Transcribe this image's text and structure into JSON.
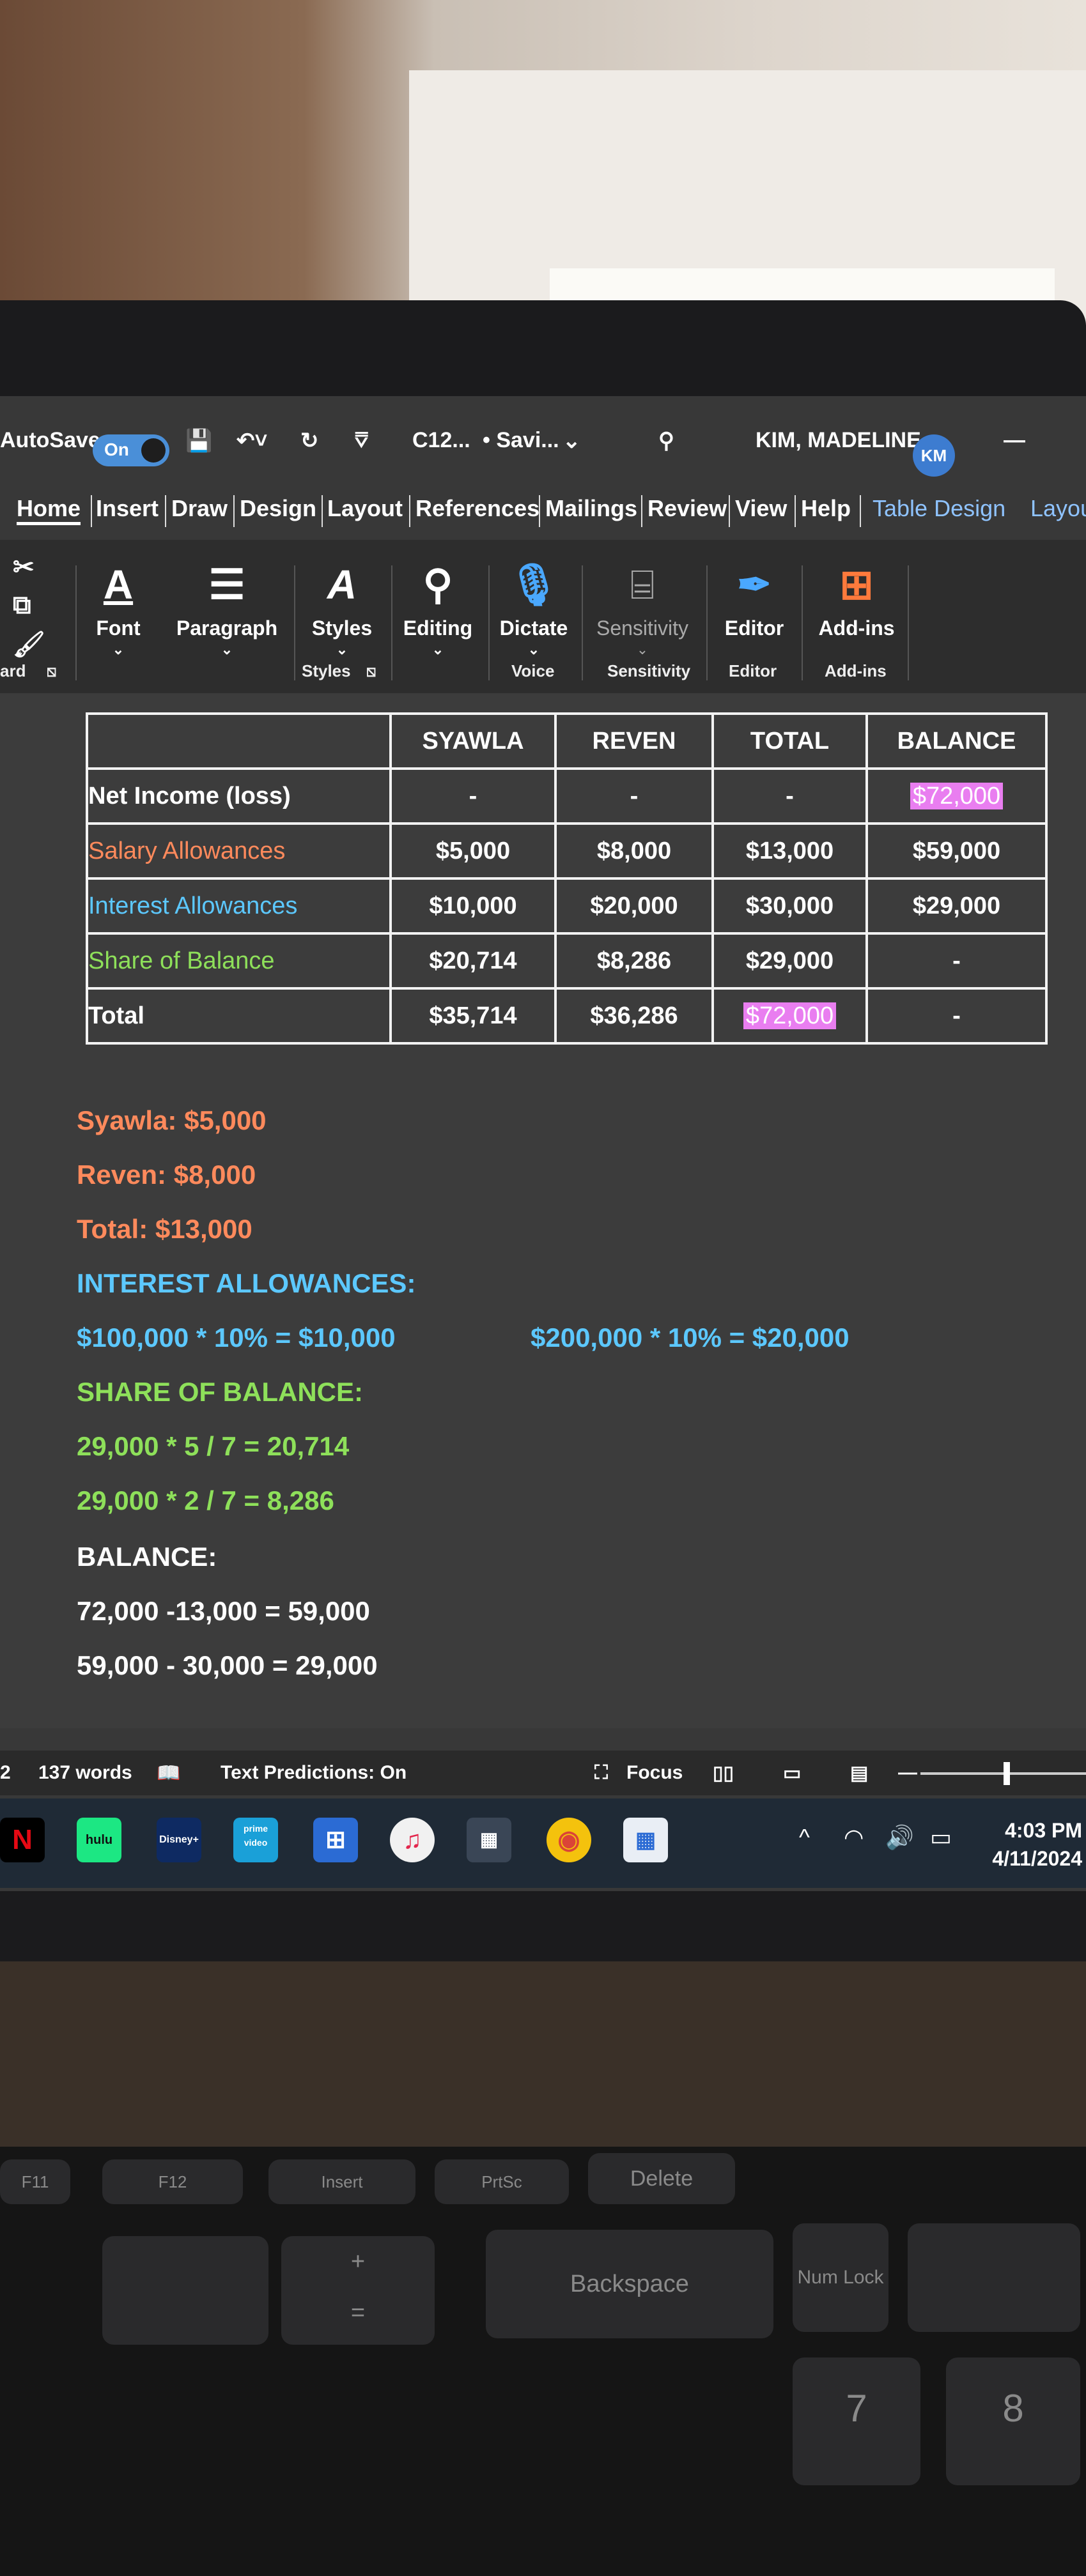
{
  "titlebar": {
    "autosave_label": "AutoSave",
    "autosave_state": "On",
    "filename": "C12...",
    "save_status": "• Savi...",
    "user_name": "KIM, MADELINE",
    "user_initials": "KM"
  },
  "tabs": [
    "Home",
    "Insert",
    "Draw",
    "Design",
    "Layout",
    "References",
    "Mailings",
    "Review",
    "View",
    "Help",
    "Table Design",
    "Layou"
  ],
  "ribbon": {
    "font": "Font",
    "paragraph": "Paragraph",
    "styles": "Styles",
    "editing": "Editing",
    "dictate": "Dictate",
    "sensitivity": "Sensitivity",
    "editor": "Editor",
    "addins": "Add-ins",
    "groups": {
      "clipboard": "ard",
      "styles": "Styles",
      "voice": "Voice",
      "sensitivity": "Sensitivity",
      "editor": "Editor",
      "addins": "Add-ins"
    }
  },
  "table": {
    "headers": [
      "",
      "SYAWLA",
      "REVEN",
      "TOTAL",
      "BALANCE"
    ],
    "rows": [
      {
        "label": "Net Income (loss)",
        "color": "#ffffff",
        "cells": [
          "-",
          "-",
          "-",
          "$72,000"
        ]
      },
      {
        "label": "Salary Allowances",
        "color": "#ff8a5c",
        "cells": [
          "$5,000",
          "$8,000",
          "$13,000",
          "$59,000"
        ]
      },
      {
        "label": "Interest Allowances",
        "color": "#5cc8ff",
        "cells": [
          "$10,000",
          "$20,000",
          "$30,000",
          "$29,000"
        ]
      },
      {
        "label": "Share of Balance",
        "color": "#8ee05a",
        "cells": [
          "$20,714",
          "$8,286",
          "$29,000",
          "-"
        ]
      },
      {
        "label": "Total",
        "color": "#ffffff",
        "cells": [
          "$35,714",
          "$36,286",
          "$72,000",
          "-"
        ]
      }
    ]
  },
  "notes": {
    "syawla": "Syawla: $5,000",
    "reven": "Reven: $8,000",
    "total": "Total: $13,000",
    "interest_heading": "INTEREST ALLOWANCES:",
    "interest_calc_1": "$100,000 * 10% = $10,000",
    "interest_calc_2": "$200,000 * 10% = $20,000",
    "share_heading": "SHARE OF BALANCE:",
    "share_calc_1": "29,000 * 5 / 7 = 20,714",
    "share_calc_2": "29,000 * 2 / 7 = 8,286",
    "balance_heading": "BALANCE:",
    "balance_calc_1": "72,000 -13,000 = 59,000",
    "balance_calc_2": "59,000 - 30,000 = 29,000"
  },
  "statusbar": {
    "page": "2",
    "words": "137 words",
    "predictions": "Text Predictions: On",
    "focus": "Focus"
  },
  "taskbar": {
    "apps": [
      "N",
      "hulu",
      "Disney+",
      "prime video"
    ],
    "time": "4:03 PM",
    "date": "4/11/2024"
  },
  "keyboard": {
    "keys": [
      "F11",
      "F12",
      "Insert",
      "PrtSc",
      "Delete",
      "Backspace",
      "Num Lock",
      "7",
      "8",
      "+",
      "="
    ]
  },
  "colors": {
    "salary": "#ff8a5c",
    "interest": "#5cc8ff",
    "share": "#8ee05a",
    "highlight": "#e97ef0",
    "accent": "#3d7cd0"
  }
}
